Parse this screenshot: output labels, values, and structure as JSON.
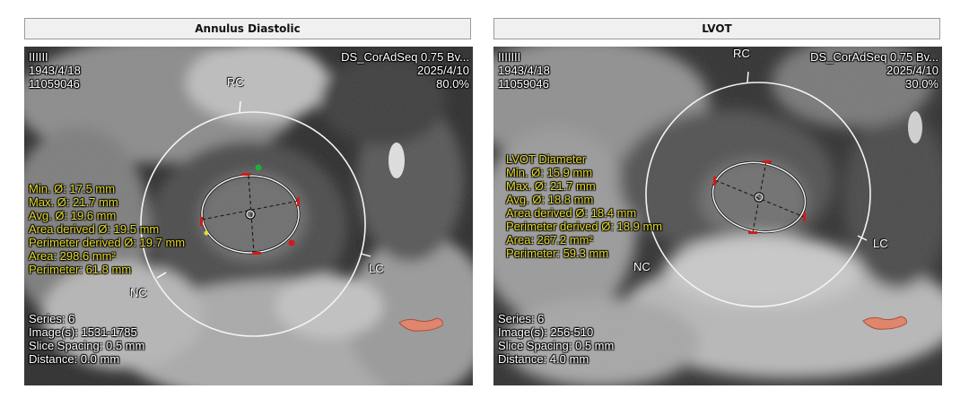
{
  "left": {
    "title": "Annulus Diastolic",
    "patient": {
      "id_line": "ΙΙΙΙΙΙ",
      "birth": "1943/4/18",
      "id": "11059046"
    },
    "series_desc": "DS_CorAdSeq 0.75 Bv...",
    "study_date": "2025/4/10",
    "phase": "80.0%",
    "measurements": [
      "Min. Ø: 17.5 mm",
      "Max. Ø: 21.7 mm",
      "Avg. Ø: 19.6 mm",
      "Area derived Ø: 19.5 mm",
      "Perimeter derived Ø: 19.7 mm",
      "Area: 298.6 mm²",
      "Perimeter: 61.8 mm"
    ],
    "info": [
      "Series: 6",
      "Image(s): 1531-1785",
      "Slice Spacing: 0.5 mm",
      "Distance: 0.0 mm"
    ],
    "labels": {
      "rc": "RC",
      "lc": "LC",
      "nc": "NC"
    }
  },
  "right": {
    "title": "LVOT",
    "patient": {
      "id_line": "ΙΙΙΙΙΙΙ",
      "birth": "1943/4/18",
      "id": "11059046"
    },
    "series_desc": "DS_CorAdSeq 0.75 Bv...",
    "study_date": "2025/4/10",
    "phase": "30.0%",
    "measurements": [
      "LVOT Diameter",
      "Min. Ø: 15.9 mm",
      "Max. Ø: 21.7 mm",
      "Avg. Ø: 18.8 mm",
      "Area derived Ø: 18.4 mm",
      "Perimeter derived Ø: 18.9 mm",
      "Area: 267.2 mm²",
      "Perimeter: 59.3 mm"
    ],
    "info": [
      "Series: 6",
      "Image(s): 256-510",
      "Slice Spacing: 0.5 mm",
      "Distance: 4.0 mm"
    ],
    "labels": {
      "rc": "RC",
      "lc": "LC",
      "nc": "NC"
    }
  },
  "colors": {
    "overlay_text": "#ffffff",
    "measurement_text": "#e6dc2e",
    "handle_red": "#d11a1a",
    "handle_green": "#1fae3a"
  }
}
